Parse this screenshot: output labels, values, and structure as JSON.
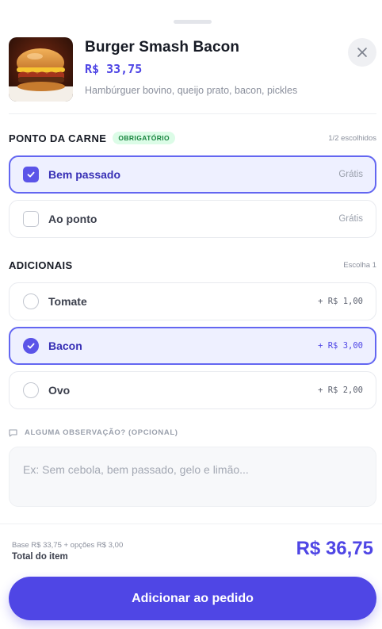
{
  "product": {
    "title": "Burger Smash Bacon",
    "price": "R$ 33,75",
    "description": "Hambúrguer bovino, queijo prato, bacon, pickles",
    "image_icon": "burger-photo"
  },
  "sections": {
    "meat": {
      "title": "PONTO DA CARNE",
      "badge": "OBRIGATÓRIO",
      "hint": "1/2 escolhidos",
      "options": [
        {
          "label": "Bem passado",
          "price": "Grátis",
          "selected": true
        },
        {
          "label": "Ao ponto",
          "price": "Grátis",
          "selected": false
        }
      ]
    },
    "extras": {
      "title": "ADICIONAIS",
      "hint": "Escolha 1",
      "options": [
        {
          "label": "Tomate",
          "price": "+ R$ 1,00",
          "selected": false
        },
        {
          "label": "Bacon",
          "price": "+ R$ 3,00",
          "selected": true
        },
        {
          "label": "Ovo",
          "price": "+ R$ 2,00",
          "selected": false
        }
      ]
    }
  },
  "note": {
    "label": "ALGUMA OBSERVAÇÃO? (OPCIONAL)",
    "placeholder": "Ex: Sem cebola, bem passado, gelo e limão..."
  },
  "footer": {
    "base": "Base R$ 33,75 + opções R$ 3,00",
    "total_label": "Total do item",
    "total_value": "R$ 36,75",
    "add_button": "Adicionar ao pedido"
  },
  "colors": {
    "accent": "#4f46e5",
    "selected_bg": "#eef0ff",
    "badge_bg": "#dcfce7",
    "badge_text": "#16833d"
  }
}
